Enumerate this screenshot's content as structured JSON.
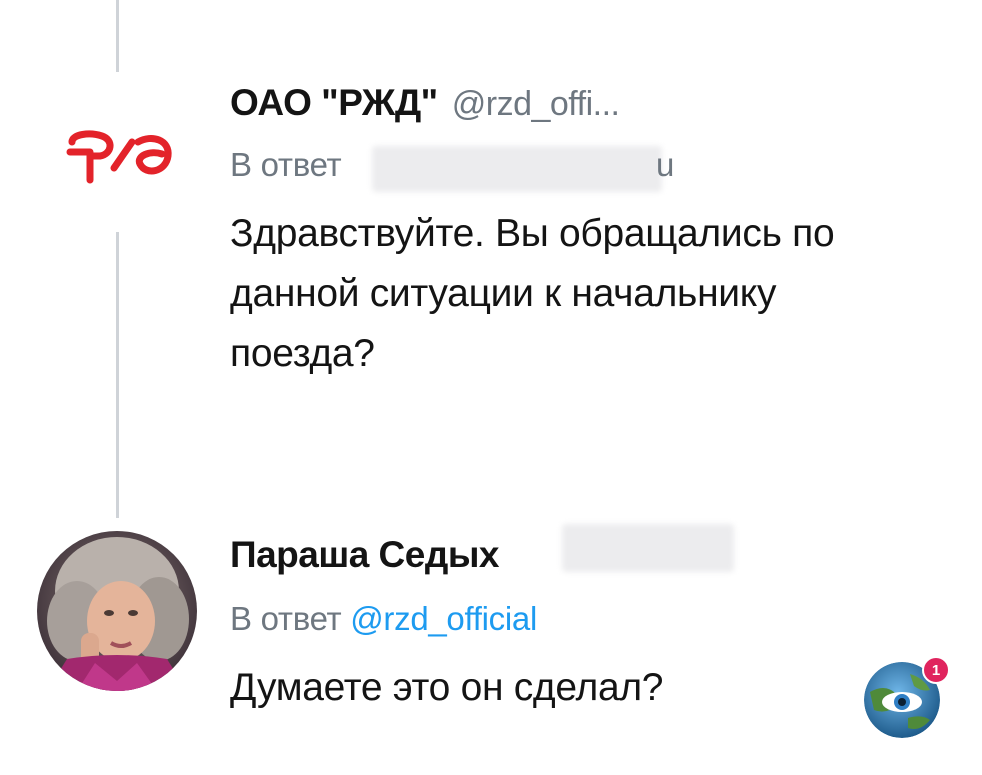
{
  "colors": {
    "accent": "#1d9bf0",
    "muted": "#6e7780",
    "text": "#141414",
    "logo": "#e3232a",
    "thread_line": "#cfd3d8",
    "notification": "#e0245e"
  },
  "tweets": [
    {
      "display_name": "ОАО \"РЖД\"",
      "handle": "@rzd_offi...",
      "reply_prefix": "В ответ",
      "reply_mention_tail": "u",
      "text_lines": [
        "Здравствуйте. Вы обращались по",
        "данной ситуации к начальнику",
        "поезда?"
      ],
      "avatar_icon": "rzd-logo-icon"
    },
    {
      "display_name": "Параша Седых",
      "reply_prefix": "В ответ",
      "reply_mention": "@rzd_official",
      "text_lines": [
        "Думаете это он сделал?"
      ],
      "avatar_icon": "user-avatar-photo"
    }
  ],
  "watermark": {
    "icon": "globe-eye-icon",
    "notification_count": "1"
  }
}
